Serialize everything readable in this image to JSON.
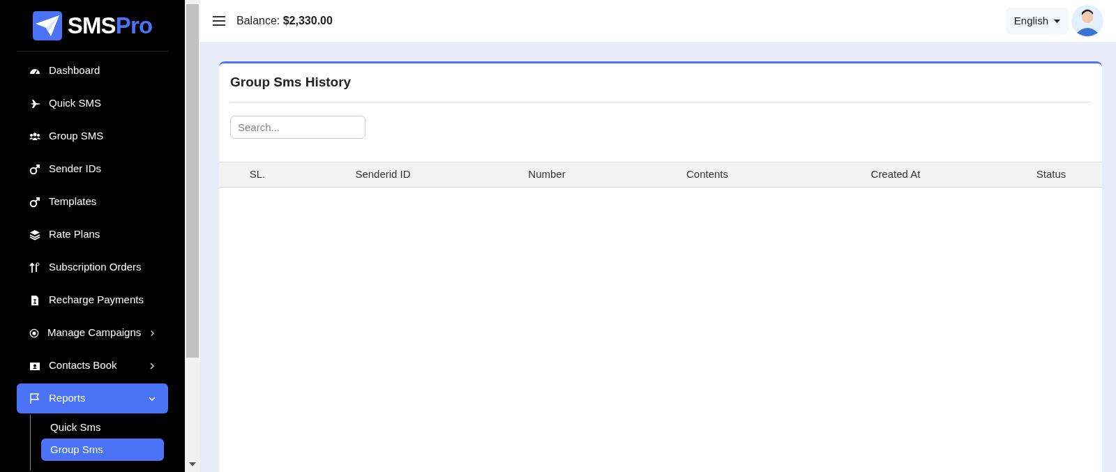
{
  "brand": {
    "name_part_1": "SMS",
    "name_part_2": "Pro"
  },
  "sidebar": {
    "items": [
      {
        "label": "Dashboard",
        "selected": false
      },
      {
        "label": "Quick SMS",
        "selected": false
      },
      {
        "label": "Group SMS",
        "selected": false
      },
      {
        "label": "Sender IDs",
        "selected": false
      },
      {
        "label": "Templates",
        "selected": false
      },
      {
        "label": "Rate Plans",
        "selected": false
      },
      {
        "label": "Subscription Orders",
        "selected": false
      },
      {
        "label": "Recharge Payments",
        "selected": false
      },
      {
        "label": "Manage Campaigns",
        "selected": false,
        "expanded": false
      },
      {
        "label": "Contacts Book",
        "selected": false,
        "expanded": false
      },
      {
        "label": "Reports",
        "selected": true,
        "expanded": true,
        "children": [
          {
            "label": "Quick Sms",
            "selected": false
          },
          {
            "label": "Group Sms",
            "selected": true
          }
        ]
      }
    ]
  },
  "header": {
    "balance_label": "Balance:",
    "balance_value": "$2,330.00",
    "language": "English"
  },
  "card": {
    "title": "Group Sms History",
    "search": {
      "placeholder": "Search..."
    },
    "table": {
      "columns": [
        "SL.",
        "Senderid ID",
        "Number",
        "Contents",
        "Created At",
        "Status"
      ]
    }
  }
}
